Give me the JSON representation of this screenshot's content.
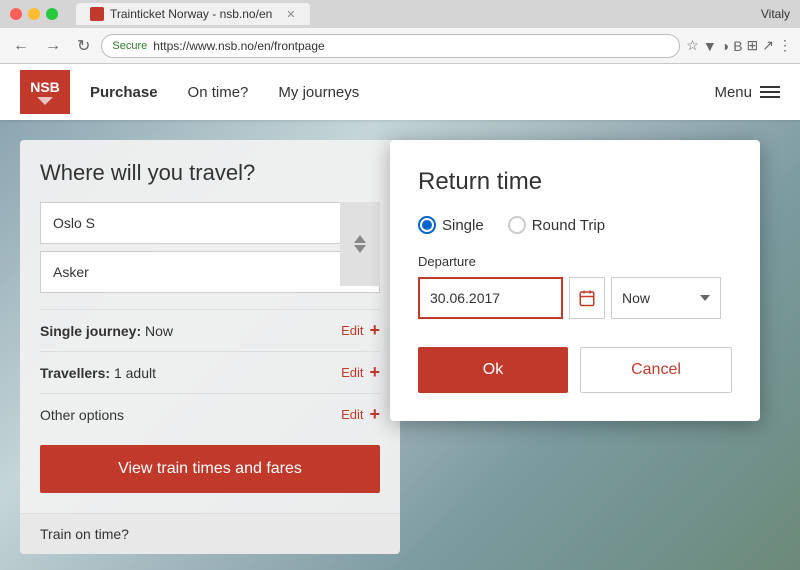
{
  "browser": {
    "tab_title": "Trainticket Norway - nsb.no/en",
    "address": "https://www.nsb.no/en/frontpage",
    "secure_label": "Secure",
    "user": "Vitaly"
  },
  "nav": {
    "logo": "NSB",
    "links": [
      {
        "label": "Purchase",
        "active": true
      },
      {
        "label": "On time?"
      },
      {
        "label": "My journeys"
      }
    ],
    "menu_label": "Menu"
  },
  "search_panel": {
    "title": "Where will you travel?",
    "from_placeholder": "Oslo S",
    "to_placeholder": "Asker",
    "options": [
      {
        "label": "Single journey:",
        "value": "Now",
        "edit": "Edit"
      },
      {
        "label": "Travellers:",
        "value": "1 adult",
        "edit": "Edit"
      },
      {
        "label": "Other options",
        "edit": "Edit"
      }
    ],
    "view_btn_label": "View train times and fares",
    "footer_label": "Train on time?"
  },
  "modal": {
    "title": "Return time",
    "radio_options": [
      {
        "label": "Single",
        "selected": true
      },
      {
        "label": "Round Trip",
        "selected": false
      }
    ],
    "departure_label": "Departure",
    "date_value": "30.06.2017",
    "time_value": "Now",
    "ok_label": "Ok",
    "cancel_label": "Cancel"
  }
}
